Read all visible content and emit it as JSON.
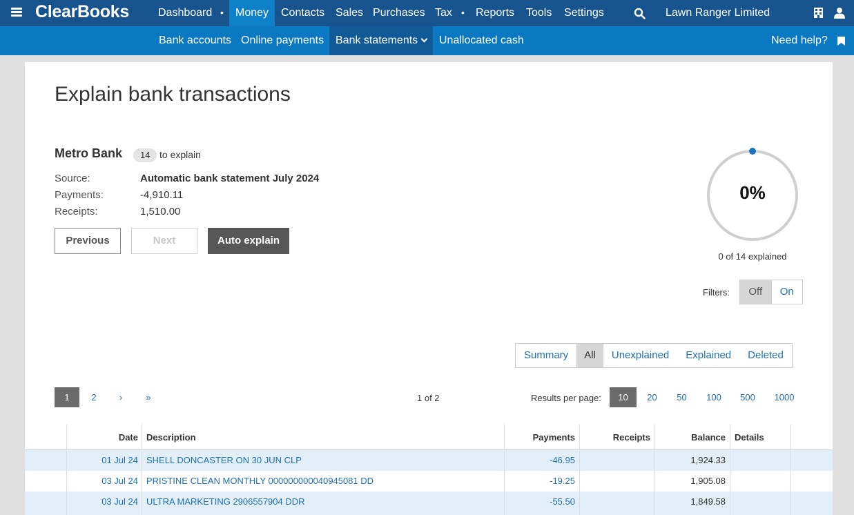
{
  "nav": {
    "logo": "ClearBooks",
    "items": [
      "Dashboard",
      "Money",
      "Contacts",
      "Sales",
      "Purchases",
      "Tax",
      "Reports",
      "Tools",
      "Settings"
    ],
    "dot": "•",
    "company": "Lawn Ranger Limited"
  },
  "subnav": {
    "items": [
      "Bank accounts",
      "Online payments",
      "Bank statements",
      "Unallocated cash"
    ],
    "help": "Need help?"
  },
  "page": {
    "title": "Explain bank transactions",
    "bank_name": "Metro Bank",
    "count": "14",
    "to_explain": "to explain",
    "source_label": "Source:",
    "source_value": "Automatic bank statement July 2024",
    "payments_label": "Payments:",
    "payments_value": "-4,910.11",
    "receipts_label": "Receipts:",
    "receipts_value": "1,510.00",
    "buttons": {
      "previous": "Previous",
      "next": "Next",
      "auto": "Auto explain"
    },
    "progress": {
      "percent_text": "0%",
      "fraction": 0,
      "caption": "0 of 14 explained"
    },
    "filters": {
      "label": "Filters:",
      "off": "Off",
      "on": "On"
    },
    "views": [
      "Summary",
      "All",
      "Unexplained",
      "Explained",
      "Deleted"
    ],
    "pagination": {
      "pages": [
        "1",
        "2",
        "›",
        "»"
      ],
      "info": "1 of 2"
    },
    "results_per_page": {
      "label": "Results per page:",
      "options": [
        "10",
        "20",
        "50",
        "100",
        "500",
        "1000"
      ]
    }
  },
  "table": {
    "headers": {
      "date": "Date",
      "description": "Description",
      "payments": "Payments",
      "receipts": "Receipts",
      "balance": "Balance",
      "details": "Details"
    },
    "rows": [
      {
        "date": "01 Jul 24",
        "description": "SHELL DONCASTER ON 30 JUN CLP",
        "payment": "-46.95",
        "receipt": "",
        "balance": "1,924.33"
      },
      {
        "date": "03 Jul 24",
        "description": "PRISTINE CLEAN MONTHLY 000000000040945081 DD",
        "payment": "-19.25",
        "receipt": "",
        "balance": "1,905.08"
      },
      {
        "date": "03 Jul 24",
        "description": "ULTRA MARKETING 2906557904 DDR",
        "payment": "-55.50",
        "receipt": "",
        "balance": "1,849.58"
      }
    ]
  },
  "colors": {
    "topbar": "#17538c",
    "subbar": "#0a79c2",
    "active_tab": "#0e80c8",
    "link": "#1f6fb5",
    "row_highlight": "#e2eff8"
  }
}
